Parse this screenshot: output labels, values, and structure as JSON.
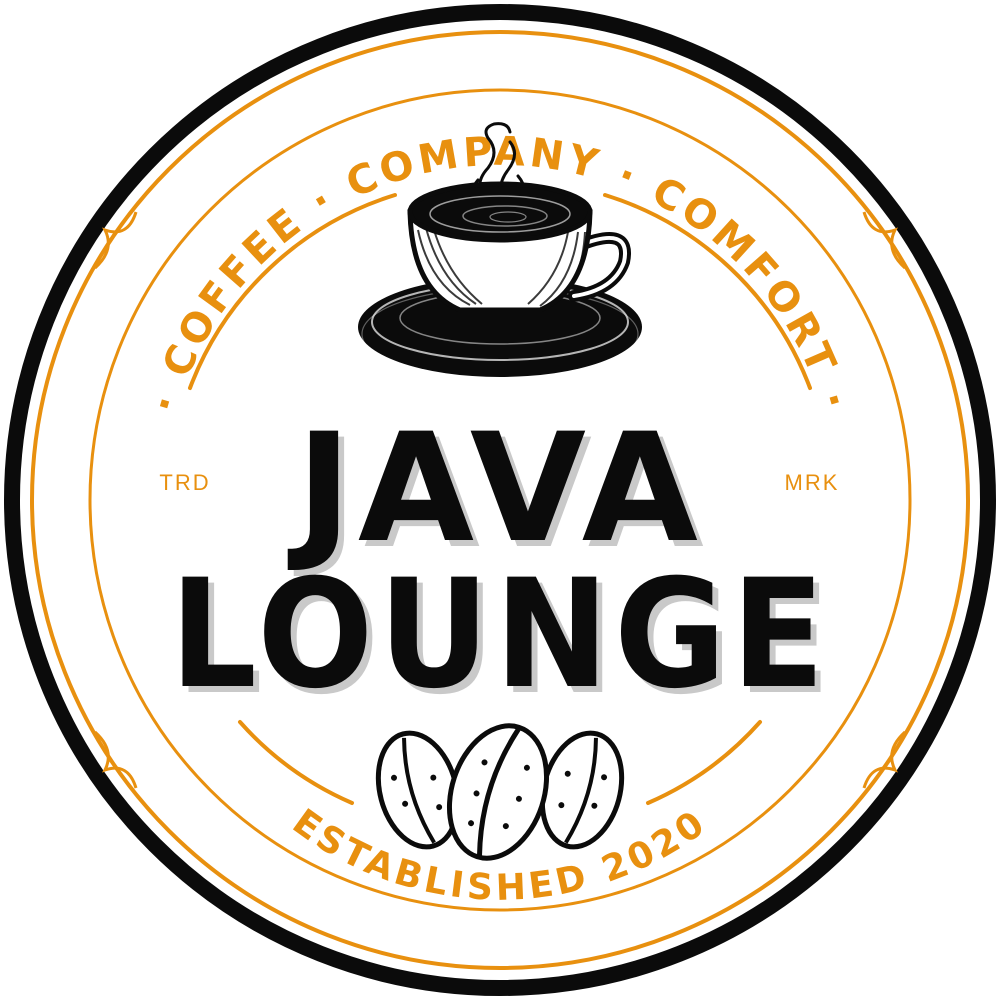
{
  "badge": {
    "tagline": "· COFFEE · COMPANY · COMFORT ·",
    "title_line1": "JAVA",
    "title_line2": "LOUNGE",
    "left_mark": "TRD",
    "right_mark": "MRK",
    "established": "ESTABLISHED 2020"
  },
  "icons": {
    "top": "coffee-cup-icon",
    "bottom": "coffee-beans-icon"
  },
  "colors": {
    "accent": "#E8900F",
    "ink": "#0B0B0B",
    "background": "#FFFFFF",
    "shadow": "#C9C9C9"
  }
}
